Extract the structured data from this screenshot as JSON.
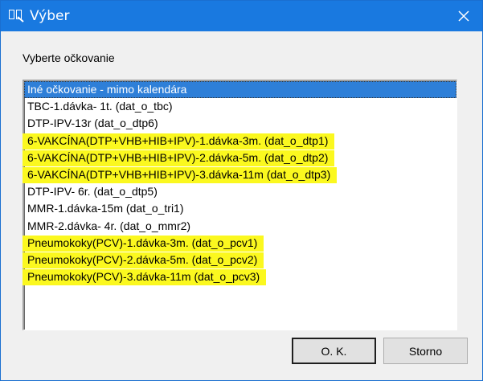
{
  "window": {
    "title": "Výber",
    "close_label": "✕"
  },
  "prompt": "Vyberte očkovanie",
  "list": {
    "items": [
      {
        "label": "Iné očkovanie - mimo kalendára",
        "selected": true,
        "highlight": false
      },
      {
        "label": "TBC-1.dávka- 1t.  (dat_o_tbc)",
        "selected": false,
        "highlight": false
      },
      {
        "label": "DTP-IPV-13r  (dat_o_dtp6)",
        "selected": false,
        "highlight": false
      },
      {
        "label": "6-VAKCÍNA(DTP+VHB+HIB+IPV)-1.dávka-3m.  (dat_o_dtp1)",
        "selected": false,
        "highlight": true
      },
      {
        "label": "6-VAKCÍNA(DTP+VHB+HIB+IPV)-2.dávka-5m.  (dat_o_dtp2)",
        "selected": false,
        "highlight": true
      },
      {
        "label": "6-VAKCÍNA(DTP+VHB+HIB+IPV)-3.dávka-11m  (dat_o_dtp3)",
        "selected": false,
        "highlight": true
      },
      {
        "label": "DTP-IPV- 6r.  (dat_o_dtp5)",
        "selected": false,
        "highlight": false
      },
      {
        "label": "MMR-1.dávka-15m  (dat_o_tri1)",
        "selected": false,
        "highlight": false
      },
      {
        "label": "MMR-2.dávka- 4r.  (dat_o_mmr2)",
        "selected": false,
        "highlight": false
      },
      {
        "label": "Pneumokoky(PCV)-1.dávka-3m.  (dat_o_pcv1)",
        "selected": false,
        "highlight": true
      },
      {
        "label": "Pneumokoky(PCV)-2.dávka-5m.  (dat_o_pcv2)",
        "selected": false,
        "highlight": true
      },
      {
        "label": "Pneumokoky(PCV)-3.dávka-11m  (dat_o_pcv3)",
        "selected": false,
        "highlight": true
      }
    ]
  },
  "buttons": {
    "ok_label": "O. K.",
    "cancel_label": "Storno"
  },
  "colors": {
    "titlebar": "#1979e0",
    "selection": "#2e7fd8",
    "highlight_marker": "#fbf81f"
  },
  "icons": {
    "app": "app-icon",
    "close": "close-icon"
  }
}
